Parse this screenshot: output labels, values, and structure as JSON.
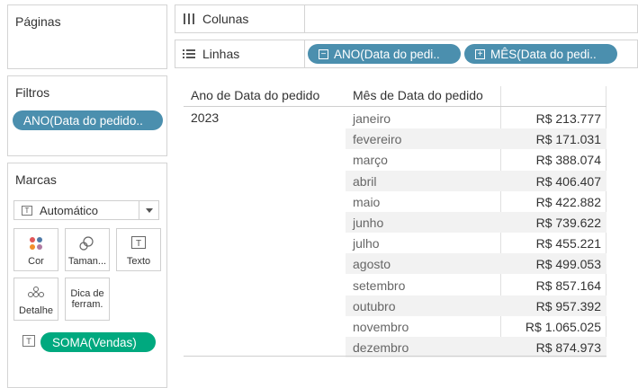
{
  "pages": {
    "title": "Páginas"
  },
  "filters": {
    "title": "Filtros",
    "pill": "ANO(Data do pedido.."
  },
  "marks": {
    "title": "Marcas",
    "type_selected": "Automático",
    "buttons": {
      "color": "Cor",
      "size": "Taman...",
      "text": "Texto",
      "detail": "Detalhe",
      "tooltip": "Dica de ferram."
    },
    "measure_pill": "SOMA(Vendas)"
  },
  "shelves": {
    "columns_label": "Colunas",
    "rows_label": "Linhas",
    "rows_pills": [
      "ANO(Data do pedi..",
      "MÊS(Data do pedi.."
    ]
  },
  "table": {
    "header_year": "Ano de Data do pedido",
    "header_month": "Mês de Data do pedido",
    "year": "2023",
    "rows": [
      {
        "month": "janeiro",
        "value": "R$ 213.777"
      },
      {
        "month": "fevereiro",
        "value": "R$ 171.031"
      },
      {
        "month": "março",
        "value": "R$ 388.074"
      },
      {
        "month": "abril",
        "value": "R$ 406.407"
      },
      {
        "month": "maio",
        "value": "R$ 422.882"
      },
      {
        "month": "junho",
        "value": "R$ 739.622"
      },
      {
        "month": "julho",
        "value": "R$ 455.221"
      },
      {
        "month": "agosto",
        "value": "R$ 499.053"
      },
      {
        "month": "setembro",
        "value": "R$ 857.164"
      },
      {
        "month": "outubro",
        "value": "R$ 957.392"
      },
      {
        "month": "novembro",
        "value": "R$ 1.065.025"
      },
      {
        "month": "dezembro",
        "value": "R$ 874.973"
      }
    ]
  },
  "colors": {
    "dimension_pill": "#4b8fae",
    "measure_pill": "#00a97f",
    "alt_row": "#f2f2f2"
  }
}
